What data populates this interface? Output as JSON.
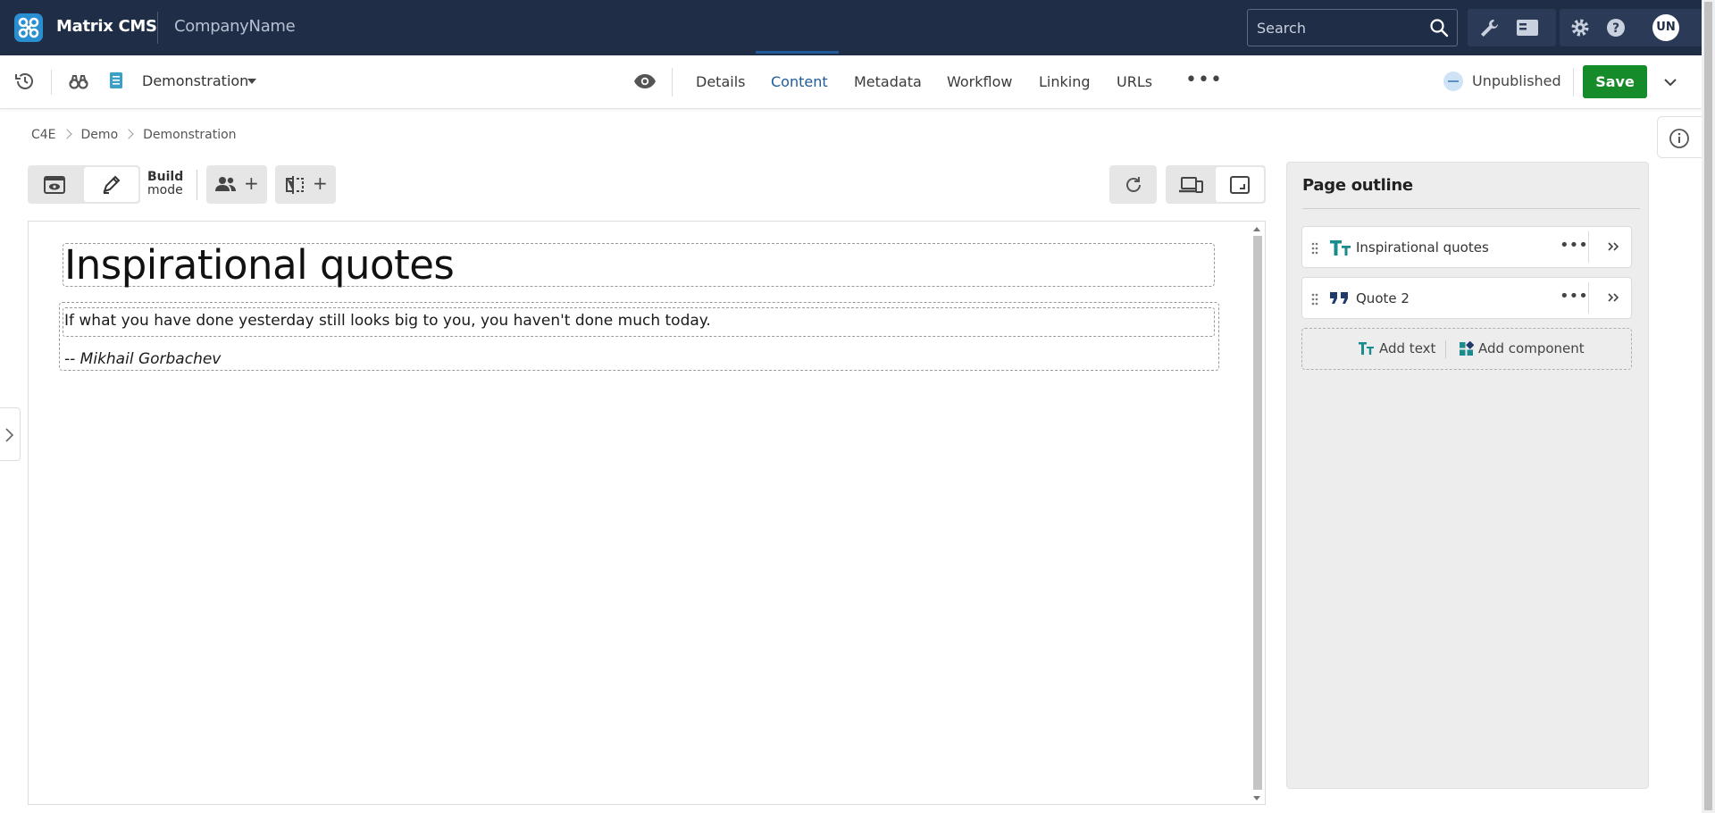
{
  "topbar": {
    "app_name": "Matrix CMS",
    "company": "CompanyName",
    "search_placeholder": "Search",
    "avatar_initials": "UN"
  },
  "toolbar": {
    "asset_name": "Demonstration",
    "tabs": [
      {
        "label": "Details",
        "active": false
      },
      {
        "label": "Content",
        "active": true
      },
      {
        "label": "Metadata",
        "active": false
      },
      {
        "label": "Workflow",
        "active": false
      },
      {
        "label": "Linking",
        "active": false
      },
      {
        "label": "URLs",
        "active": false
      }
    ],
    "more_label": "•••",
    "status": "Unpublished",
    "save_label": "Save"
  },
  "breadcrumb": [
    "C4E",
    "Demo",
    "Demonstration"
  ],
  "editor": {
    "build_mode_line1": "Build",
    "build_mode_line2": "mode",
    "plus": "+"
  },
  "content": {
    "heading": "Inspirational quotes",
    "quote": "If what you have done yesterday still looks big to you, you haven't done much today.",
    "author": "-- Mikhail Gorbachev"
  },
  "outline": {
    "title": "Page outline",
    "items": [
      {
        "label": "Inspirational quotes",
        "icon": "text-type-icon"
      },
      {
        "label": "Quote 2",
        "icon": "quote-icon"
      }
    ],
    "item_menu": "•••",
    "add_text": "Add text",
    "add_component": "Add component"
  },
  "colors": {
    "topbar": "#1f2d47",
    "accent": "#1e5a9c",
    "save": "#158b2a",
    "teal": "#1a8c8f"
  }
}
